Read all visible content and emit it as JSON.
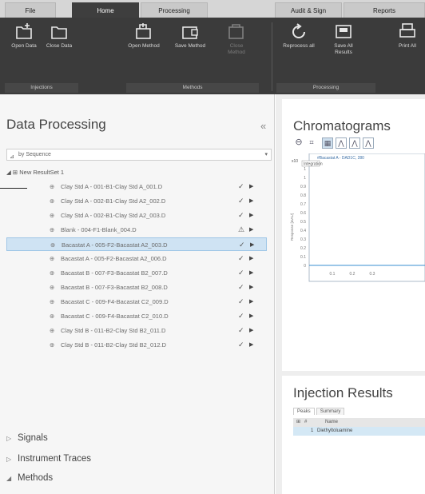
{
  "ribbon": {
    "tabs": [
      "File",
      "Home",
      "Processing",
      "Audit & Sign",
      "Reports"
    ],
    "buttons": [
      {
        "label": "Open Data",
        "icon": "open-data-icon"
      },
      {
        "label": "Close Data",
        "icon": "close-data-icon"
      },
      {
        "label": "Open Method",
        "icon": "open-method-icon"
      },
      {
        "label": "Save Method",
        "icon": "save-method-icon"
      },
      {
        "label": "Close Method",
        "icon": "close-method-icon"
      },
      {
        "label": "Reprocess all",
        "icon": "reprocess-icon"
      },
      {
        "label": "Save All Results",
        "icon": "save-all-results-icon"
      },
      {
        "label": "Print All",
        "icon": "print-icon"
      }
    ],
    "groups": [
      "Injections",
      "Methods",
      "Processing"
    ]
  },
  "left_panel": {
    "title": "Data Processing",
    "combo_value": "by Sequence",
    "tree_root": "New ResultSet 1",
    "rows": [
      {
        "text": "Clay Std A - 001-B1-Clay Std A_001.D",
        "status": "✓"
      },
      {
        "text": "Clay Std A - 002-B1-Clay Std A2_002.D",
        "status": "✓"
      },
      {
        "text": "Clay Std A - 002-B1-Clay Std A2_003.D",
        "status": "✓"
      },
      {
        "text": "Blank - 004-F1-Blank_004.D",
        "status": "⚠"
      },
      {
        "text": "Bacastat A - 005-F2-Bacastat A2_003.D",
        "status": "✓"
      },
      {
        "text": "Bacastat A - 005-F2-Bacastat A2_006.D",
        "status": "✓"
      },
      {
        "text": "Bacastat B - 007-F3-Bacastat B2_007.D",
        "status": "✓"
      },
      {
        "text": "Bacastat B - 007-F3-Bacastat B2_008.D",
        "status": "✓"
      },
      {
        "text": "Bacastat C - 009-F4-Bacastat C2_009.D",
        "status": "✓"
      },
      {
        "text": "Bacastat C - 009-F4-Bacastat C2_010.D",
        "status": "✓"
      },
      {
        "text": "Clay Std B - 011-B2-Clay Std B2_011.D",
        "status": "✓"
      },
      {
        "text": "Clay Std B - 011-B2-Clay Std B2_012.D",
        "status": "✓"
      }
    ],
    "sections": [
      "Signals",
      "Instrument Traces",
      "Methods"
    ]
  },
  "right_panel": {
    "chromatograms_title": "Chromatograms",
    "plot": {
      "trace_label": "#Bacastat A - DAD1C, 280",
      "sub_label": "Integration",
      "y_exponent": "x10",
      "y_ticks": [
        "1",
        "1",
        "0.9",
        "0.8",
        "0.7",
        "0.6",
        "0.5",
        "0.4",
        "0.3",
        "0.2",
        "0.1",
        "0"
      ],
      "x_ticks": [
        "0.1",
        "0.2",
        "0.3"
      ],
      "y_axis_label": "Response [mAU]"
    },
    "injection_title": "Injection Results",
    "injection_tabs": [
      "Peaks",
      "Summary"
    ],
    "injection_headers": [
      "#",
      "Name"
    ],
    "injection_rows": [
      {
        "num": "1",
        "name": "Diethyltoluamine"
      }
    ]
  }
}
